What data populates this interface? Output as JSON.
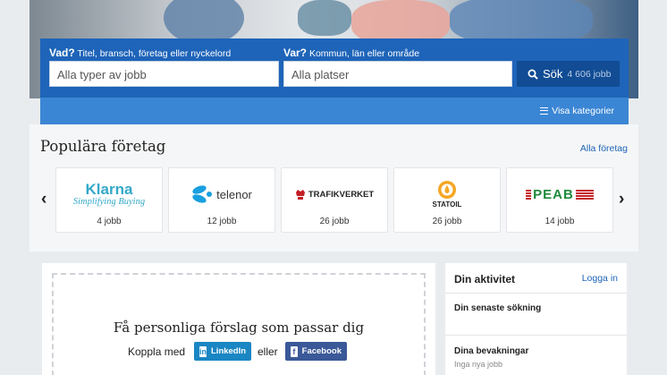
{
  "search": {
    "what_label_bold": "Vad?",
    "what_label_rest": "Titel, bransch, företag eller nyckelord",
    "what_placeholder": "Alla typer av jobb",
    "where_label_bold": "Var?",
    "where_label_rest": "Kommun, län eller område",
    "where_placeholder": "Alla platser",
    "button_label": "Sök",
    "button_count": "4 606 jobb",
    "categories_link": "Visa kategorier"
  },
  "companies": {
    "title": "Populära företag",
    "all_link": "Alla företag",
    "prev_arrow": "‹",
    "next_arrow": "›",
    "items": [
      {
        "name": "Klarna",
        "tagline": "Simplifying Buying",
        "jobs": "4 jobb"
      },
      {
        "name": "telenor",
        "jobs": "12 jobb"
      },
      {
        "name": "TRAFIKVERKET",
        "jobs": "26 jobb"
      },
      {
        "name": "STATOIL",
        "jobs": "26 jobb"
      },
      {
        "name": "PEAB",
        "jobs": "14 jobb"
      }
    ]
  },
  "personal": {
    "title": "Få personliga förslag som passar dig",
    "connect_label": "Koppla med",
    "or_label": "eller",
    "linkedin_label": "LinkedIn",
    "facebook_label": "Facebook"
  },
  "activity": {
    "title": "Din aktivitet",
    "login_link": "Logga in",
    "latest_search": "Din senaste sökning",
    "watches": "Dina bevakningar",
    "watches_sub": "Inga nya jobb"
  },
  "colors": {
    "primary": "#1e64b9",
    "primary_dark": "#114c94",
    "strip": "#3b86d4",
    "linkedin": "#1a86c3",
    "facebook": "#3b5998"
  }
}
